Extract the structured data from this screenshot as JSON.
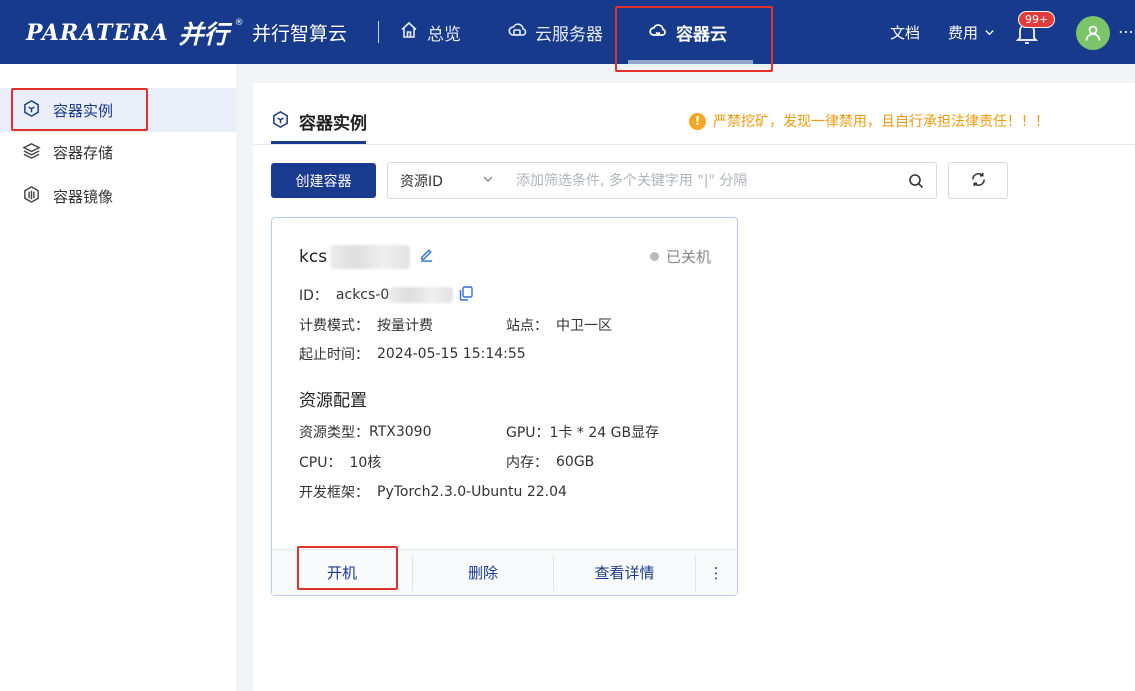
{
  "header": {
    "logo_text": "PARATERA",
    "logo_cn": "并行",
    "logo_reg": "®",
    "brand": "并行智算云",
    "nav": [
      {
        "label": "总览",
        "icon": "home-icon"
      },
      {
        "label": "云服务器",
        "icon": "cloud-server-icon"
      },
      {
        "label": "容器云",
        "icon": "container-cloud-icon",
        "active": true
      }
    ],
    "docs": "文档",
    "fees": "费用",
    "notif_badge": "99+",
    "avatar_more": "⋯"
  },
  "sidebar": {
    "items": [
      {
        "label": "容器实例",
        "icon": "container-instance-icon",
        "active": true
      },
      {
        "label": "容器存储",
        "icon": "storage-layers-icon"
      },
      {
        "label": "容器镜像",
        "icon": "image-icon"
      }
    ]
  },
  "main": {
    "title": "容器实例",
    "warning": "严禁挖矿，发现一律禁用，且自行承担法律责任！！！",
    "create_button": "创建容器",
    "filter": {
      "select": "资源ID",
      "placeholder": "添加筛选条件, 多个关键字用 \"|\" 分隔"
    }
  },
  "card": {
    "name": "kcs",
    "status": "已关机",
    "id_label": "ID：",
    "id_value": "ackcs-0",
    "billing_label": "计费模式：",
    "billing_value": "按量计费",
    "site_label": "站点：",
    "site_value": "中卫一区",
    "time_label": "起止时间：",
    "time_value": "2024-05-15 15:14:55",
    "section": "资源配置",
    "type_label": "资源类型：",
    "type_value": "RTX3090",
    "gpu_label": "GPU：",
    "gpu_value": "1卡 * 24 GB显存",
    "cpu_label": "CPU：",
    "cpu_value": "10核",
    "mem_label": "内存：",
    "mem_value": "60GB",
    "framework_label": "开发框架：",
    "framework_value": "PyTorch2.3.0-Ubuntu 22.04",
    "actions": {
      "start": "开机",
      "delete": "删除",
      "details": "查看详情",
      "more": "⋮"
    }
  },
  "colors": {
    "topbar": "#173a8c",
    "primary": "#1a3a8f",
    "warning": "#f09a0e",
    "highlight_frame": "#e0322a"
  }
}
